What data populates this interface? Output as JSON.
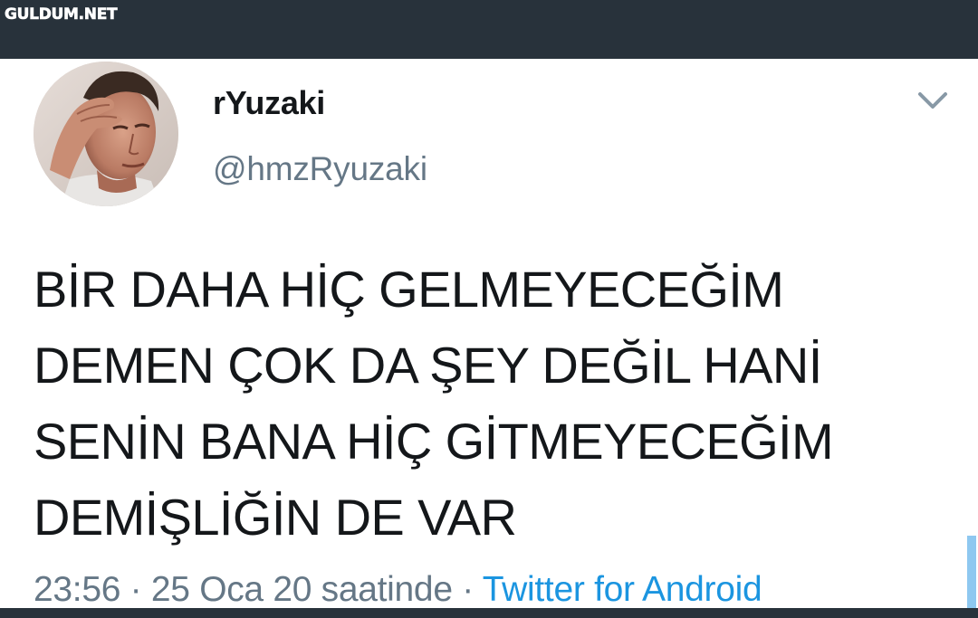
{
  "watermark": {
    "text": "GULDUM.NET"
  },
  "tweet": {
    "author": {
      "display_name": "rYuzaki",
      "handle": "@hmzRyuzaki"
    },
    "text_lines": [
      "BİR DAHA HİÇ GELMEYECEĞİM",
      "DEMEN ÇOK DA ŞEY DEĞİL HANİ",
      "SENİN BANA HİÇ GİTMEYECEĞİM",
      "DEMİŞLİĞİN DE VAR"
    ],
    "meta": {
      "time": "23:56",
      "separator": " · ",
      "date": "25 Oca 20 saatinde",
      "source": "Twitter for Android"
    }
  },
  "icons": {
    "menu": "chevron-down-icon",
    "avatar": "avatar"
  },
  "colors": {
    "top_bar": "#28323b",
    "name": "#14171a",
    "secondary": "#657786",
    "link": "#1b95e0",
    "background": "#ffffff"
  }
}
